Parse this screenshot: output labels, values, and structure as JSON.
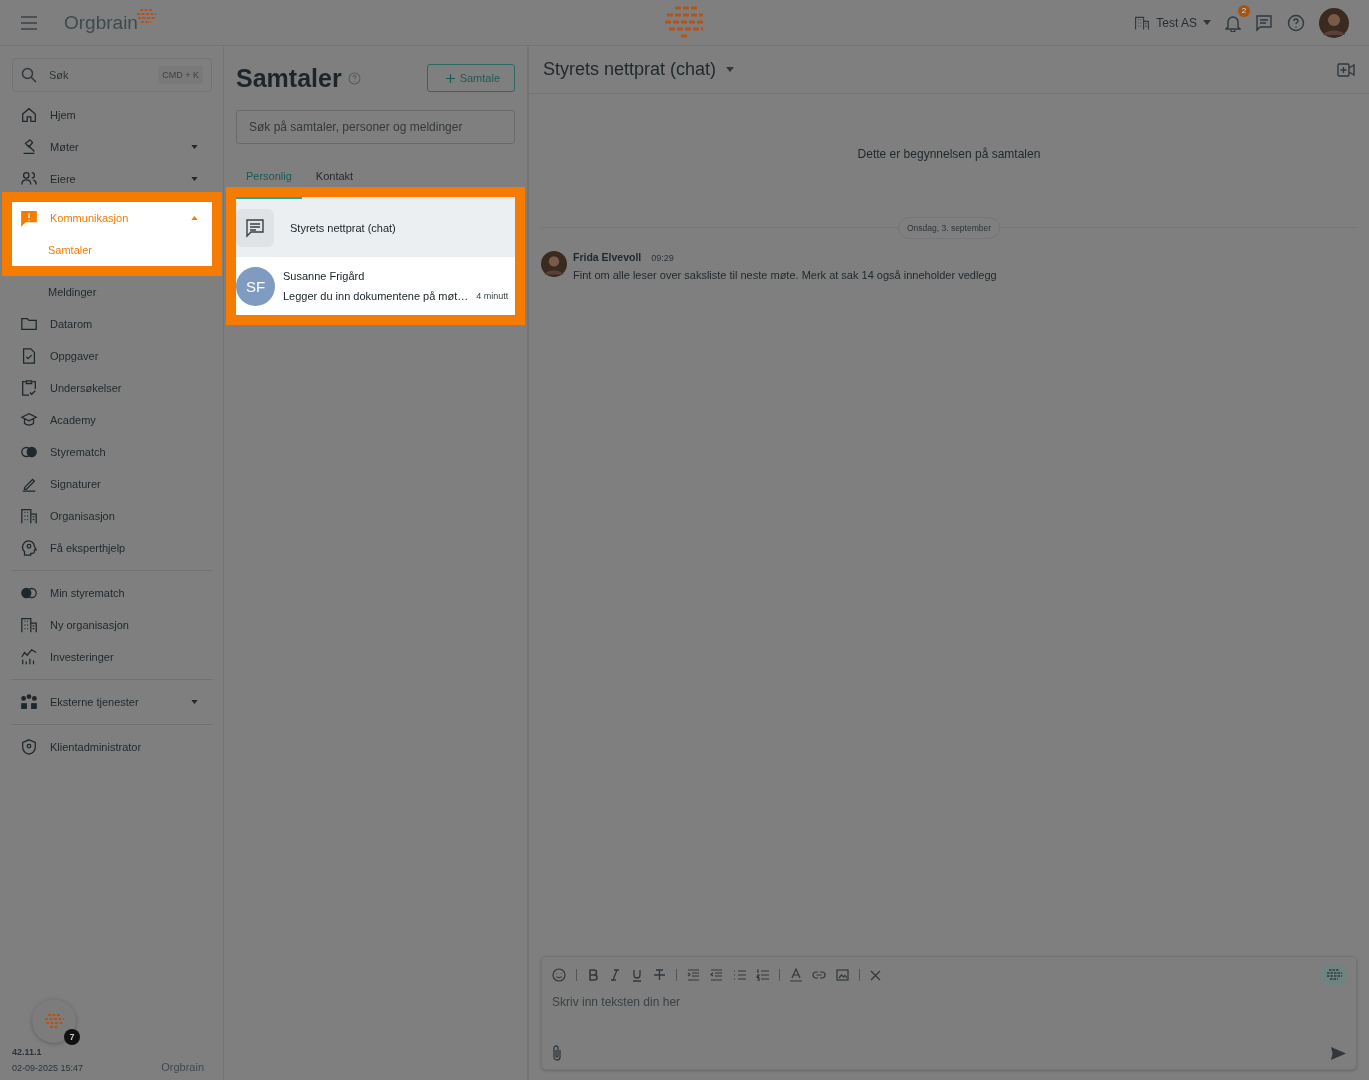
{
  "topbar": {
    "brand": "Orgbrain",
    "organization": "Test AS",
    "notification_count": "2"
  },
  "sidebar": {
    "search": {
      "placeholder": "Søk",
      "shortcut": "CMD + K"
    },
    "sections": [
      {
        "items": [
          {
            "label": "Hjem"
          },
          {
            "label": "Møter",
            "expanded": false
          },
          {
            "label": "Eiere",
            "expanded": false
          },
          {
            "label": "Kommunikasjon",
            "expanded": true,
            "selected": true,
            "spotlight": true,
            "children": [
              {
                "label": "Samtaler",
                "selected": true,
                "spotlight": true
              },
              {
                "label": "Meldinger",
                "selected": false,
                "spotlight": false
              }
            ]
          },
          {
            "label": "Datarom"
          },
          {
            "label": "Oppgaver"
          },
          {
            "label": "Undersøkelser"
          },
          {
            "label": "Academy"
          },
          {
            "label": "Styrematch"
          },
          {
            "label": "Signaturer"
          },
          {
            "label": "Organisasjon"
          },
          {
            "label": "Få eksperthjelp"
          }
        ]
      },
      {
        "items": [
          {
            "label": "Min styrematch"
          },
          {
            "label": "Ny organisasjon"
          },
          {
            "label": "Investeringer"
          }
        ]
      },
      {
        "items": [
          {
            "label": "Eksterne tjenester",
            "expanded": false
          }
        ]
      },
      {
        "items": [
          {
            "label": "Klientadministrator"
          }
        ]
      }
    ],
    "footer": {
      "badge": "7",
      "version": "42.11.1",
      "timestamp": "02-09-2025 15:47",
      "brand": "Orgbrain"
    }
  },
  "conversations": {
    "title": "Samtaler",
    "new_button": "Samtale",
    "search": {
      "placeholder": "Søk på samtaler, personer og meldinger"
    },
    "tabs": [
      {
        "label": "Personlig",
        "selected": true
      },
      {
        "label": "Kontakt",
        "selected": false
      }
    ],
    "spotlight": true,
    "items": [
      {
        "kind": "group",
        "name": "Styrets nettprat (chat)",
        "selected": true
      },
      {
        "kind": "person",
        "initials": "SF",
        "name": "Susanne Frigård",
        "preview": "Legger du inn dokumentene på møt…",
        "time": "4 minutt",
        "selected": false
      }
    ]
  },
  "chat": {
    "title": "Styrets nettprat (chat)",
    "start_note": "Dette er begynnelsen på samtalen",
    "date_divider": "Onsdag, 3. september",
    "messages": [
      {
        "author": "Frida Elvevoll",
        "time": "09:29",
        "text": "Fint om alle leser over saksliste til neste møte. Merk at sak 14 også inneholder vedlegg"
      }
    ],
    "composer": {
      "placeholder": "Skriv inn teksten din her"
    }
  }
}
